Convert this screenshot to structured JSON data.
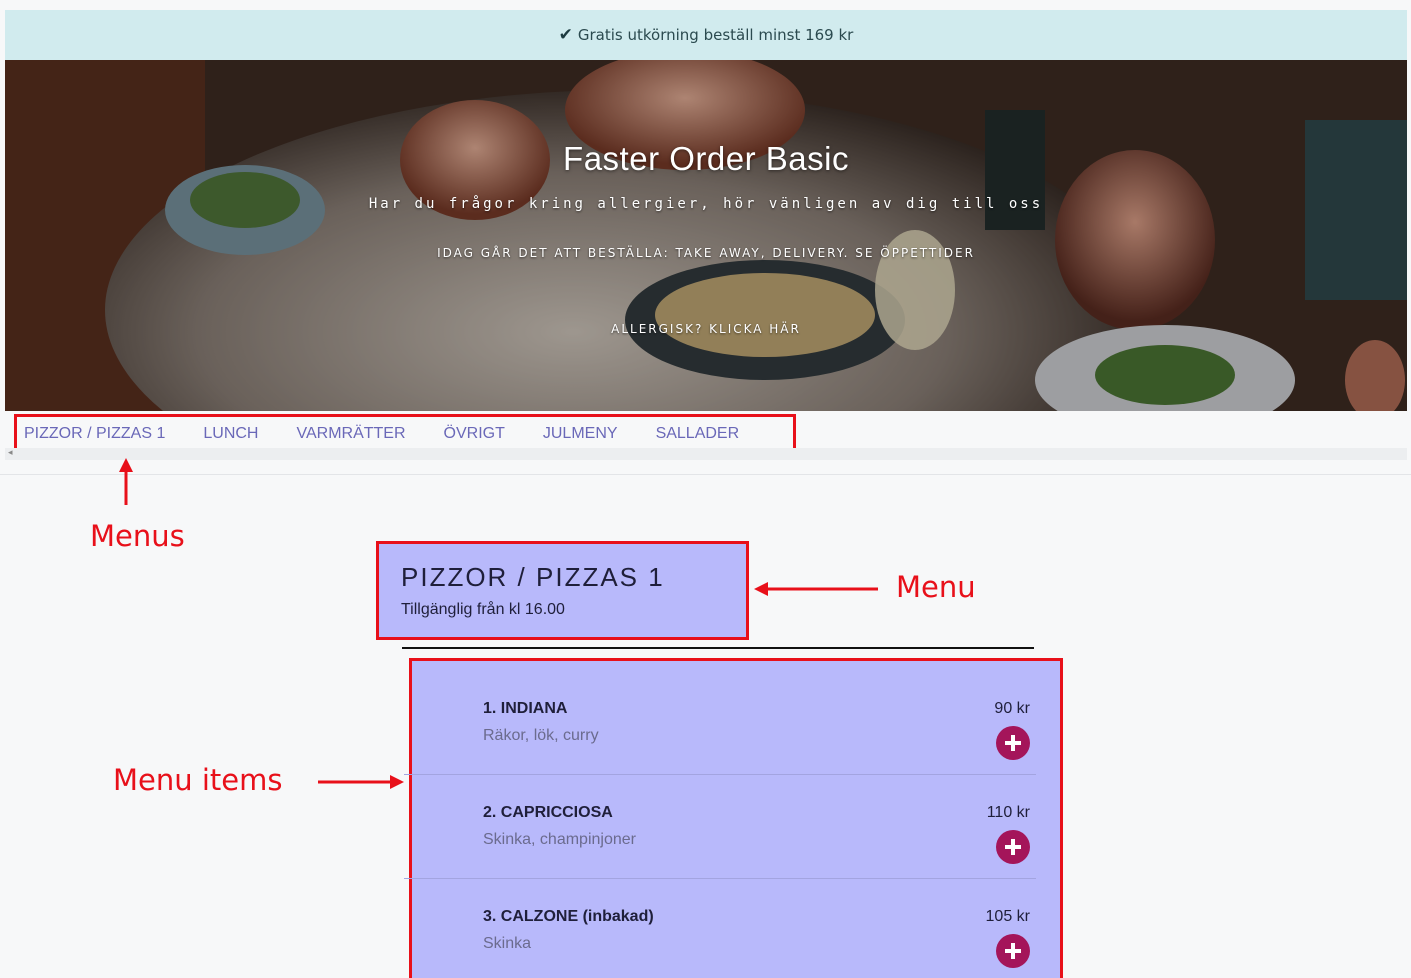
{
  "banner": {
    "text": "Gratis utkörning beställ minst 169 kr",
    "icon": "check-icon"
  },
  "hero": {
    "title": "Faster Order Basic",
    "subtitle": "Har du frågor kring allergier, hör vänligen av dig till oss",
    "today_text": "IDAG GÅR DET ATT BESTÄLLA: TAKE AWAY, DELIVERY. SE ÖPPETTIDER",
    "allergy_link": "ALLERGISK? KLICKA HÄR"
  },
  "nav": {
    "items": [
      {
        "label": "PIZZOR / PIZZAS 1"
      },
      {
        "label": "LUNCH"
      },
      {
        "label": "VARMRÄTTER"
      },
      {
        "label": "ÖVRIGT"
      },
      {
        "label": "JULMENY"
      },
      {
        "label": "SALLADER"
      }
    ]
  },
  "annotations": {
    "menus": "Menus",
    "menu": "Menu",
    "menu_items": "Menu items"
  },
  "menu": {
    "title": "PIZZOR / PIZZAS 1",
    "subtitle": "Tillgänglig från kl 16.00"
  },
  "items": [
    {
      "name": "1. INDIANA",
      "desc": "Räkor, lök, curry",
      "price": "90 kr"
    },
    {
      "name": "2. CAPRICCIOSA",
      "desc": "Skinka, champinjoner",
      "price": "110 kr"
    },
    {
      "name": "3. CALZONE (inbakad)",
      "desc": "Skinka",
      "price": "105 kr"
    }
  ],
  "colors": {
    "banner_bg": "#d1ebee",
    "nav_text": "#6a68b8",
    "highlight_bg": "#b8b9fb",
    "annotation_red": "#e8101a",
    "add_button": "#a4155a"
  }
}
